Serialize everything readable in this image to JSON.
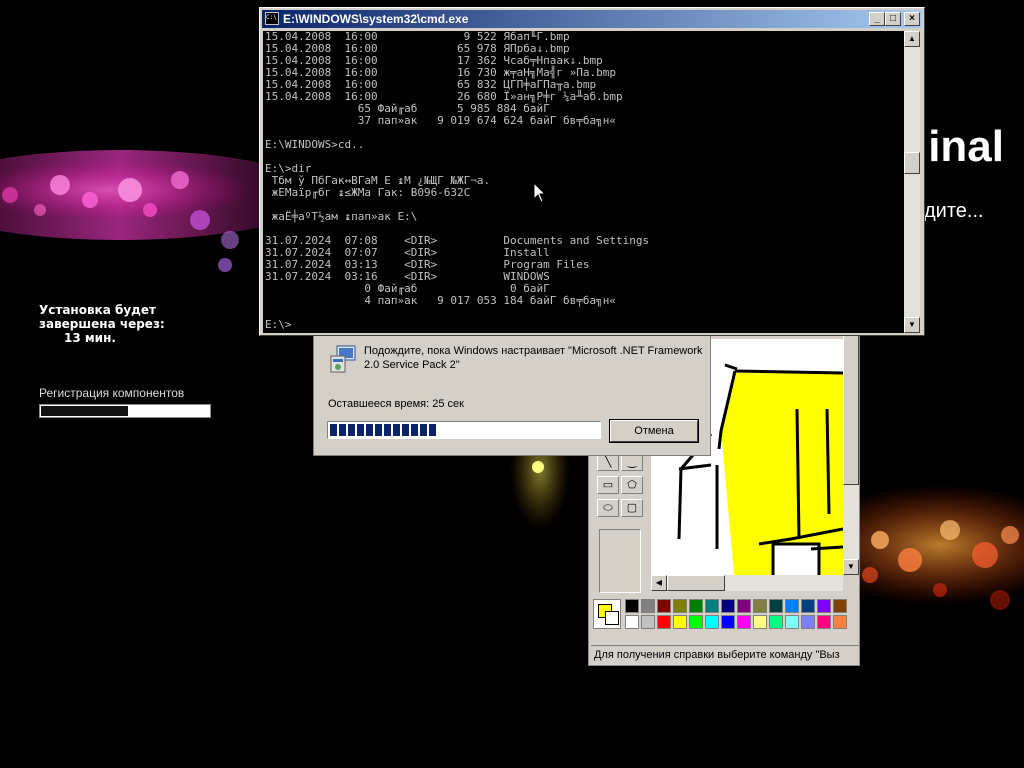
{
  "background": {
    "title_fragment": "inal",
    "subtitle_fragment": "дите..."
  },
  "setup_status": {
    "line1": "Установка будет",
    "line2": "завершена через:",
    "line3": "13 мин.",
    "phase_label": "Регистрация компонентов",
    "phase_progress_percent": 52
  },
  "cmd_window": {
    "title": "E:\\WINDOWS\\system32\\cmd.exe",
    "icon_label": "C:\\",
    "minimize_glyph": "_",
    "maximize_glyph": "□",
    "close_glyph": "×",
    "console_text": "15.04.2008  16:00             9 522 Ябап╙Г.bmp\n15.04.2008  16:00            65 978 ЯПрба↓.bmp\n15.04.2008  16:00            17 362 Чсаб╤Нпаак↓.bmp\n15.04.2008  16:00            16 730 ж╤аН╗Ма╣г »Па.bmp\n15.04.2008  16:00            65 832 ЦГП╪аГПа╥а.bmp\n15.04.2008  16:00            26 680 Ї»ан╗Р╪г ¼а╨аб.bmp\n              65 Фай╓аб      5 985 884 байГ\n              37 пап»ак   9 019 674 624 байГ бв╤ба╗н«\n\nE:\\WINDOWS>cd..\n\nE:\\>dir\n Тбм ў ПбГак↔ВГаМ Е ↨М ¿№ЩГ №ЖГ¬а.\n жЕМаїр╓бг ↨≤ЖМа Гак: B096-632C\n\n жаЁ╪аºТ½ам ↨пап»ак E:\\\n\n31.07.2024  07:08    <DIR>          Documents and Settings\n31.07.2024  07:07    <DIR>          Install\n31.07.2024  03:13    <DIR>          Program Files\n31.07.2024  03:16    <DIR>          WINDOWS\n               0 Фай╓аб              0 байГ\n               4 пап»ак   9 017 053 184 байГ бв╤ба╗н«\n\nE:\\>"
  },
  "setup_dialog": {
    "message": "Подождите, пока Windows настраивает \"Microsoft .NET Framework 2.0 Service Pack 2\"",
    "time_remaining": "Оставшееся время: 25 сек",
    "progress_blocks": 12,
    "progress_percent": 40,
    "cancel_label": "Отмена"
  },
  "paint_window": {
    "status_text": "Для получения справки выберите команду \"Выз",
    "foreground_color": "#ffff00",
    "background_color": "#ffffff",
    "palette_row1": [
      "#000000",
      "#808080",
      "#800000",
      "#808000",
      "#008000",
      "#008080",
      "#000080",
      "#800080",
      "#808040",
      "#004040",
      "#0080ff",
      "#004080",
      "#8000ff",
      "#804000"
    ],
    "palette_row2": [
      "#ffffff",
      "#c0c0c0",
      "#ff0000",
      "#ffff00",
      "#00ff00",
      "#00ffff",
      "#0000ff",
      "#ff00ff",
      "#ffff80",
      "#00ff80",
      "#80ffff",
      "#8080ff",
      "#ff0080",
      "#ff8040"
    ]
  }
}
